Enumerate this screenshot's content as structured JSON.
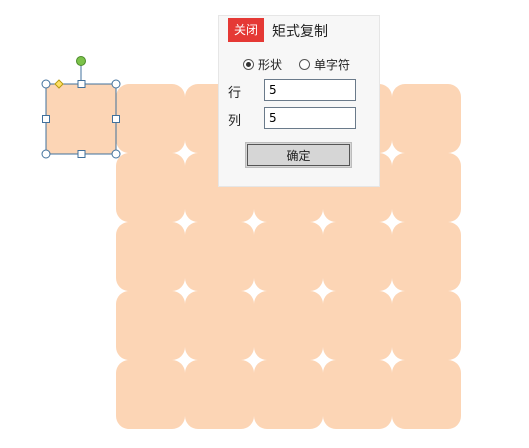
{
  "canvas": {
    "colors": {
      "tile": "#fcd5b5",
      "selection_stroke": "#41719c",
      "accent_close": "#e53935"
    },
    "grid": {
      "rows": 5,
      "cols": 5
    }
  },
  "dialog": {
    "close_label": "关闭",
    "title": "矩式复制",
    "mode_options": [
      {
        "label": "形状",
        "checked": true
      },
      {
        "label": "单字符",
        "checked": false
      }
    ],
    "rows_label": "行",
    "rows_value": "5",
    "cols_label": "列",
    "cols_value": "5",
    "ok_label": "确定"
  }
}
